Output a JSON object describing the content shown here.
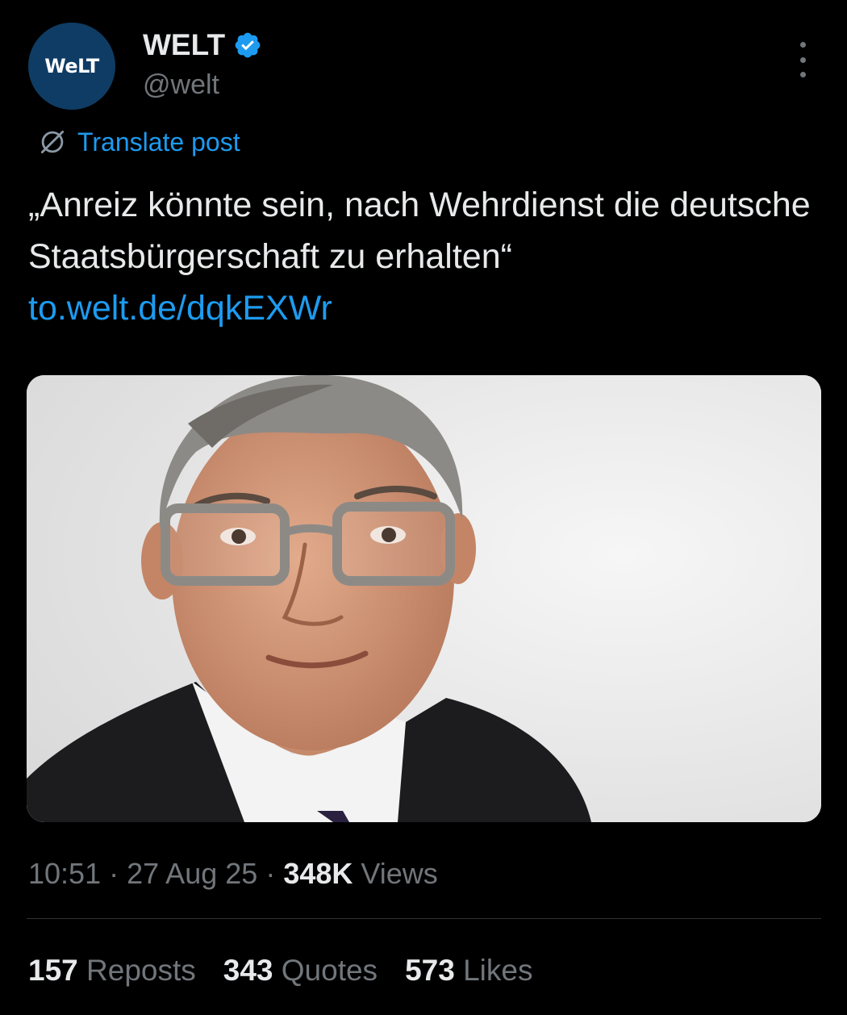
{
  "account": {
    "avatar_text": "WeLT",
    "display_name": "WELT",
    "handle": "@welt",
    "verified": true,
    "avatar_color": "#0f3c64",
    "verified_color": "#1d9bf0"
  },
  "translate": {
    "icon": "globe-slash-icon",
    "label": "Translate post"
  },
  "post": {
    "text": "„Anreiz könnte sein, nach Wehrdienst die deutsche Staatsbürgerschaft zu erhalten“",
    "link": "to.welt.de/dqkEXWr",
    "link_color": "#1d9bf0"
  },
  "media": {
    "description": "portrait photo of a man with grey hair and glasses"
  },
  "meta": {
    "time": "10:51",
    "separator": "·",
    "date": "27 Aug 25",
    "views_count": "348K",
    "views_label": "Views"
  },
  "stats": {
    "reposts_count": "157",
    "reposts_label": "Reposts",
    "quotes_count": "343",
    "quotes_label": "Quotes",
    "likes_count": "573",
    "likes_label": "Likes"
  },
  "menu": {
    "icon": "more-vertical-icon"
  }
}
